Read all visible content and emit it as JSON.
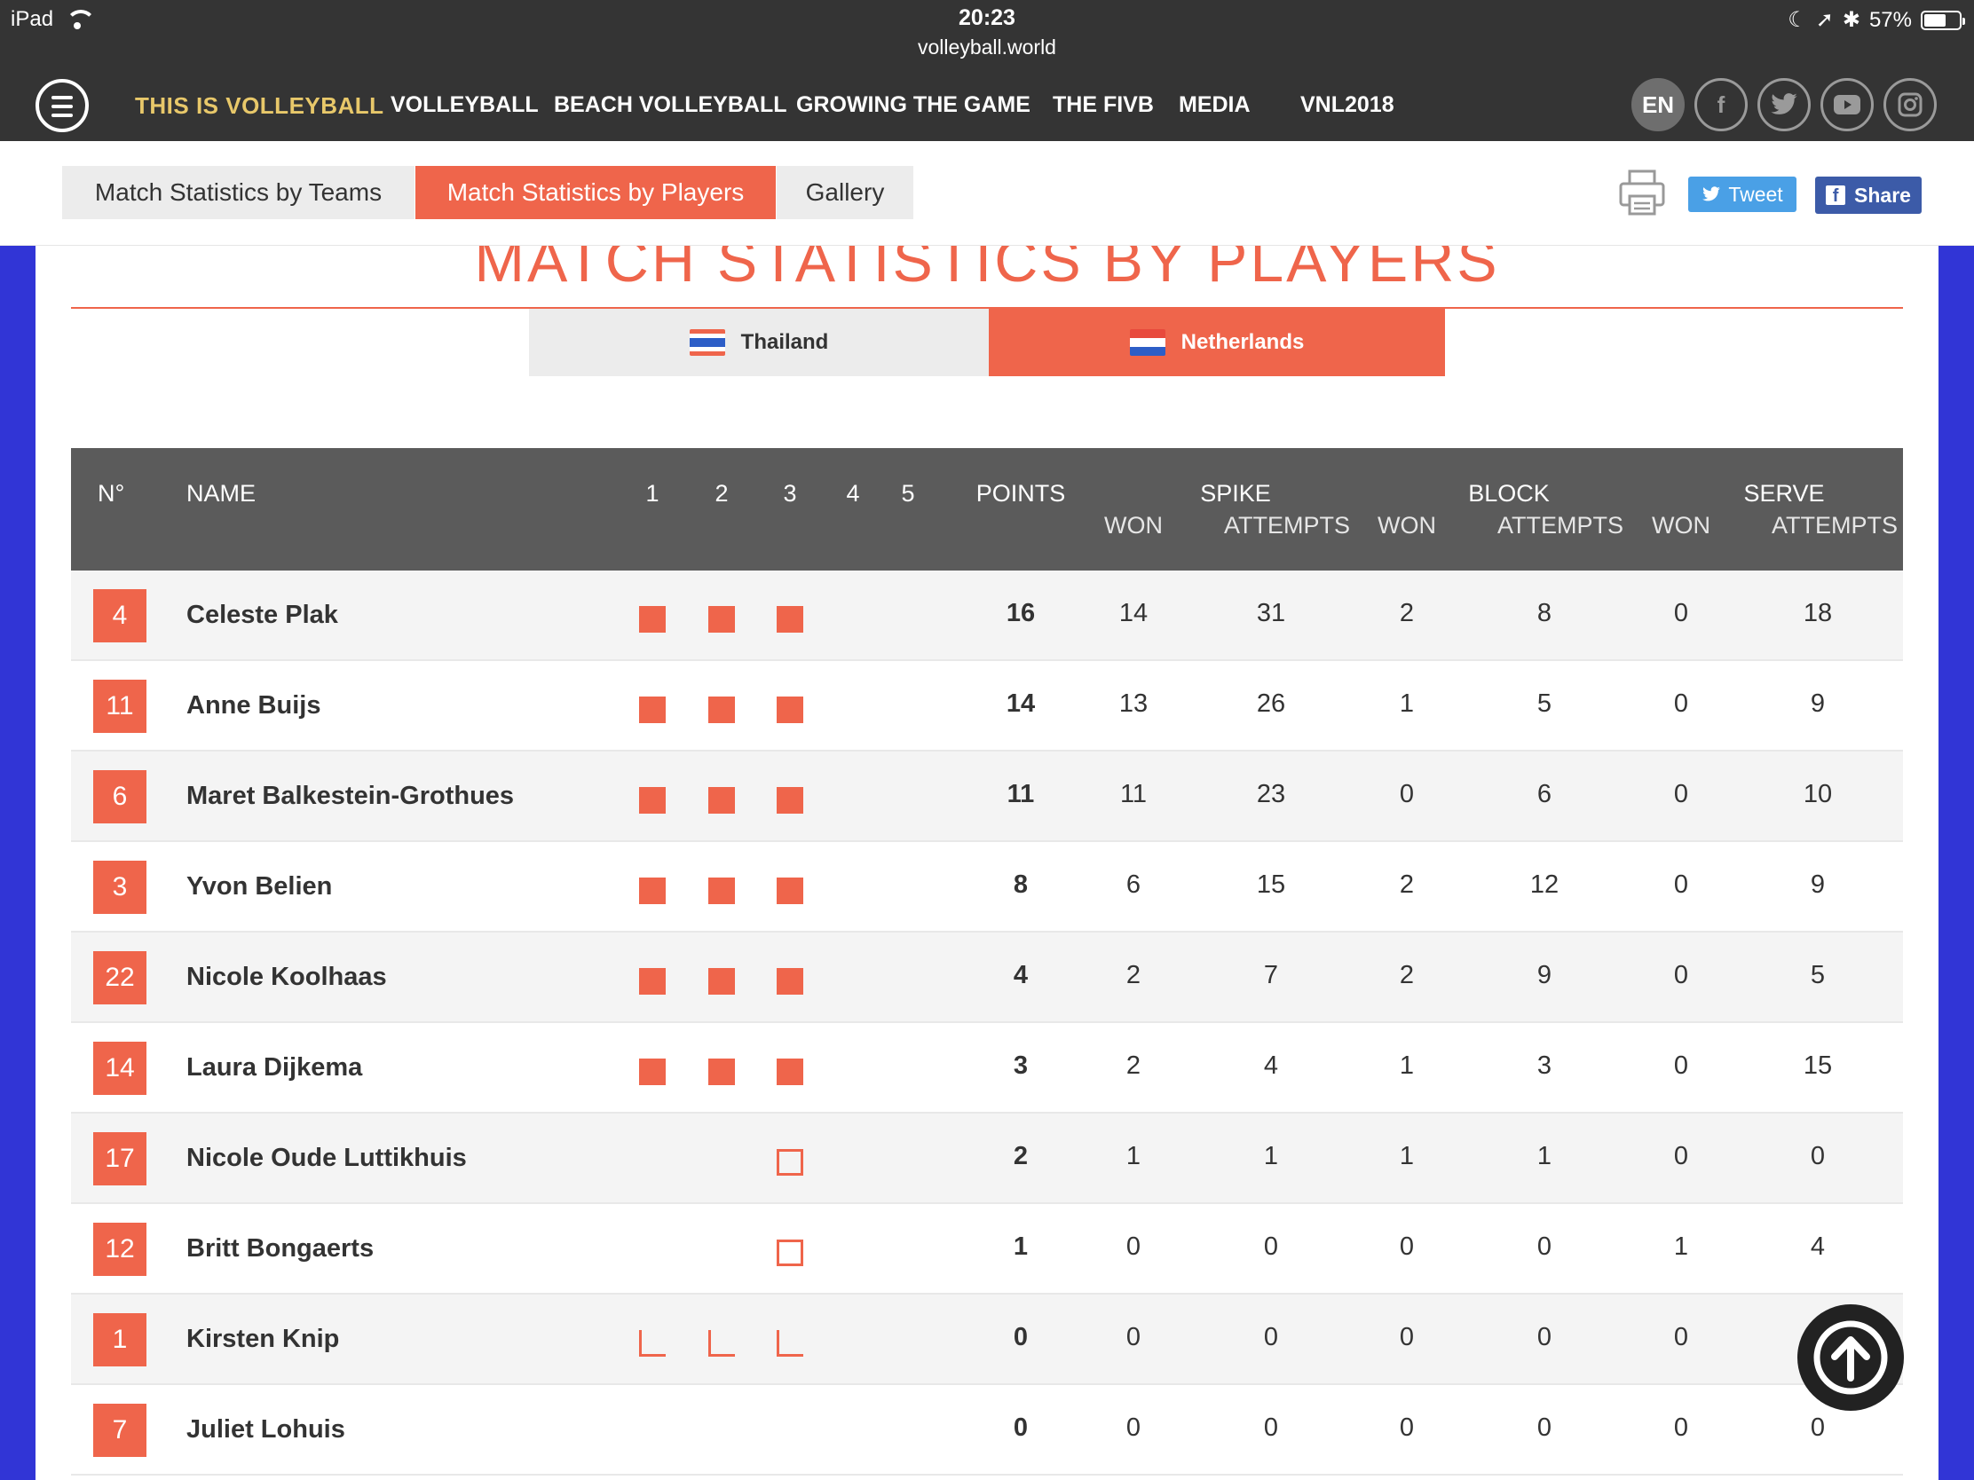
{
  "status_bar": {
    "device": "iPad",
    "time": "20:23",
    "url": "volleyball.world",
    "battery": "57%"
  },
  "nav": {
    "brand": "THIS IS VOLLEYBALL",
    "items": [
      "VOLLEYBALL",
      "BEACH VOLLEYBALL",
      "GROWING THE GAME",
      "THE FIVB",
      "MEDIA",
      "VNL2018"
    ],
    "language": "EN"
  },
  "subnav": {
    "tabs": [
      "Match Statistics by Teams",
      "Match Statistics by Players",
      "Gallery"
    ],
    "active_tab": "Match Statistics by Players",
    "tweet_label": "Tweet",
    "share_label": "Share"
  },
  "heading": "MATCH STATISTICS BY PLAYERS",
  "teams": {
    "thailand": "Thailand",
    "netherlands": "Netherlands",
    "active": "Netherlands"
  },
  "table": {
    "headers": {
      "num": "N°",
      "name": "NAME",
      "sets": [
        "1",
        "2",
        "3",
        "4",
        "5"
      ],
      "points": "POINTS",
      "spike": "SPIKE",
      "block": "BLOCK",
      "serve": "SERVE",
      "won": "WON",
      "attempts": "ATTEMPTS"
    },
    "rows": [
      {
        "num": "4",
        "name": "Celeste Plak",
        "sets": [
          "full",
          "full",
          "full",
          "",
          ""
        ],
        "points": "16",
        "spike_won": "14",
        "spike_att": "31",
        "block_won": "2",
        "block_att": "8",
        "serve_won": "0",
        "serve_att": "18"
      },
      {
        "num": "11",
        "name": "Anne Buijs",
        "sets": [
          "full",
          "full",
          "full",
          "",
          ""
        ],
        "points": "14",
        "spike_won": "13",
        "spike_att": "26",
        "block_won": "1",
        "block_att": "5",
        "serve_won": "0",
        "serve_att": "9"
      },
      {
        "num": "6",
        "name": "Maret Balkestein-Grothues",
        "sets": [
          "full",
          "full",
          "full",
          "",
          ""
        ],
        "points": "11",
        "spike_won": "11",
        "spike_att": "23",
        "block_won": "0",
        "block_att": "6",
        "serve_won": "0",
        "serve_att": "10"
      },
      {
        "num": "3",
        "name": "Yvon Belien",
        "sets": [
          "full",
          "full",
          "full",
          "",
          ""
        ],
        "points": "8",
        "spike_won": "6",
        "spike_att": "15",
        "block_won": "2",
        "block_att": "12",
        "serve_won": "0",
        "serve_att": "9"
      },
      {
        "num": "22",
        "name": "Nicole Koolhaas",
        "sets": [
          "full",
          "full",
          "full",
          "",
          ""
        ],
        "points": "4",
        "spike_won": "2",
        "spike_att": "7",
        "block_won": "2",
        "block_att": "9",
        "serve_won": "0",
        "serve_att": "5"
      },
      {
        "num": "14",
        "name": "Laura Dijkema",
        "sets": [
          "full",
          "full",
          "full",
          "",
          ""
        ],
        "points": "3",
        "spike_won": "2",
        "spike_att": "4",
        "block_won": "1",
        "block_att": "3",
        "serve_won": "0",
        "serve_att": "15"
      },
      {
        "num": "17",
        "name": "Nicole Oude Luttikhuis",
        "sets": [
          "",
          "",
          "sub",
          "",
          ""
        ],
        "points": "2",
        "spike_won": "1",
        "spike_att": "1",
        "block_won": "1",
        "block_att": "1",
        "serve_won": "0",
        "serve_att": "0"
      },
      {
        "num": "12",
        "name": "Britt Bongaerts",
        "sets": [
          "",
          "",
          "sub",
          "",
          ""
        ],
        "points": "1",
        "spike_won": "0",
        "spike_att": "0",
        "block_won": "0",
        "block_att": "0",
        "serve_won": "1",
        "serve_att": "4"
      },
      {
        "num": "1",
        "name": "Kirsten Knip",
        "sets": [
          "lib",
          "lib",
          "lib",
          "",
          ""
        ],
        "points": "0",
        "spike_won": "0",
        "spike_att": "0",
        "block_won": "0",
        "block_att": "0",
        "serve_won": "0",
        "serve_att": ""
      },
      {
        "num": "7",
        "name": "Juliet Lohuis",
        "sets": [
          "",
          "",
          "",
          "",
          ""
        ],
        "points": "0",
        "spike_won": "0",
        "spike_att": "0",
        "block_won": "0",
        "block_att": "0",
        "serve_won": "0",
        "serve_att": "0"
      }
    ]
  },
  "colors": {
    "accent": "#ef654b",
    "header_bg": "#5b5b5b",
    "nav_bg": "#343434",
    "side_bg": "#3135d6"
  }
}
